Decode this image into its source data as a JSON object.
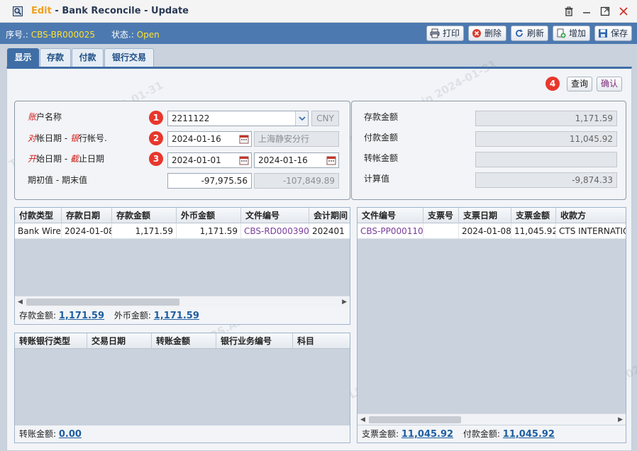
{
  "window": {
    "mode": "Edit",
    "separator": " - ",
    "title": "Bank Reconcile - Update"
  },
  "toolbar": {
    "doc_no_label": "序号.:",
    "doc_no": "CBS-BR000025",
    "status_label": "状态.:",
    "status": "Open",
    "buttons": {
      "print": "打印",
      "delete": "删除",
      "refresh": "刷新",
      "add": "增加",
      "save": "保存"
    }
  },
  "tabs": [
    "显示",
    "存款",
    "付款",
    "银行交易"
  ],
  "actions": {
    "query": "查询",
    "confirm": "确认"
  },
  "badges": [
    "1",
    "2",
    "3",
    "4"
  ],
  "form": {
    "account_name": {
      "label_red": "账",
      "label": "户名称",
      "value": "2211122",
      "currency": "CNY"
    },
    "statement_date": {
      "label_red1": "对",
      "label1": "帐日期",
      "sep": " - ",
      "label_red2": "银",
      "label2": "行帐号.",
      "value": "2024-01-16",
      "bank_account": "上海静安分行"
    },
    "date_range": {
      "label_red1": "开",
      "label1": "始日期",
      "sep": " - ",
      "label_red2": "截",
      "label2": "止日期",
      "start": "2024-01-01",
      "end": "2024-01-16"
    },
    "balances": {
      "label": "期初值 - 期末值",
      "opening": "-97,975.56",
      "closing": "-107,849.89"
    }
  },
  "summary": {
    "deposit": {
      "label": "存款金额",
      "value": "1,171.59"
    },
    "payment": {
      "label": "付款金额",
      "value": "11,045.92"
    },
    "transfer": {
      "label": "转帐金额",
      "value": ""
    },
    "computed": {
      "label": "计算值",
      "value": "-9,874.33"
    }
  },
  "deposit_grid": {
    "columns": [
      "付款类型",
      "存款日期",
      "存款金额",
      "外币金额",
      "文件编号",
      "会计期间"
    ],
    "rows": [
      {
        "type": "Bank Wire",
        "date": "2024-01-08",
        "amount": "1,171.59",
        "fx_amount": "1,171.59",
        "doc_no": "CBS-RD000390",
        "period": "202401"
      }
    ],
    "footer": {
      "deposit_label": "存款金额:",
      "deposit_total": "1,171.59",
      "fx_label": "外币金额:",
      "fx_total": "1,171.59"
    }
  },
  "payment_grid": {
    "columns": [
      "文件编号",
      "支票号",
      "支票日期",
      "支票金额",
      "收款方"
    ],
    "rows": [
      {
        "doc_no": "CBS-PP000110",
        "cheque_no": "",
        "cheque_date": "2024-01-08",
        "amount": "11,045.92",
        "payee": "CTS INTERNATIONAL"
      }
    ],
    "footer": {
      "cheque_label": "支票金额:",
      "cheque_total": "11,045.92",
      "payment_label": "付款金额:",
      "payment_total": "11,045.92"
    }
  },
  "transfer_grid": {
    "columns": [
      "转账银行类型",
      "交易日期",
      "转账金额",
      "银行业务编号",
      "科目"
    ],
    "footer": {
      "transfer_label": "转账金额:",
      "transfer_total": "0.00"
    }
  },
  "watermark": "TLKA.CBS.Admin 2024-01-31"
}
